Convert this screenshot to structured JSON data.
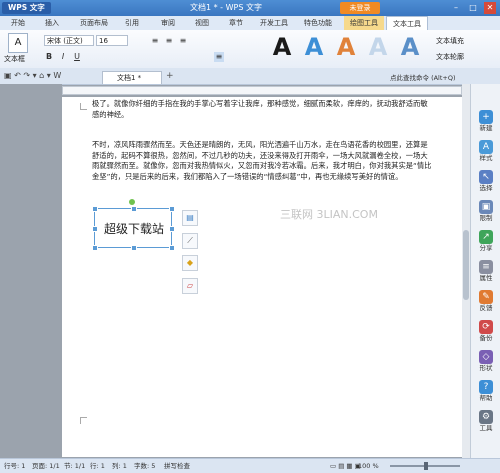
{
  "titlebar": {
    "app_button": "WPS 文字",
    "title": "文档1 * - WPS 文字",
    "login": "未登录",
    "minimize": "–",
    "maximize": "□",
    "close": "✕"
  },
  "tabs": [
    "开始",
    "插入",
    "页面布局",
    "引用",
    "审阅",
    "视图",
    "章节",
    "开发工具",
    "特色功能",
    "绘图工具",
    "文本工具"
  ],
  "ribbon": {
    "font_name": "宋体 (正文)",
    "font_size": "16",
    "textbox_label": "文本框",
    "bold": "B",
    "italic": "I",
    "underline": "U",
    "text_fill": "文本填充",
    "text_outline": "文本轮廓",
    "wordart_letters": [
      "A",
      "A",
      "A",
      "A",
      "A"
    ]
  },
  "doctab": {
    "label": "文档1 *"
  },
  "toolbar_right": {
    "hint": "点此查找命令 (Alt+Q)"
  },
  "document": {
    "para1": "极了。就像你纤细的手指在我的手掌心写着字让我痒，那种感觉，细腻而柔软，痒痒的，抚动我舒适而敏感的神经。",
    "para2": "不时，凉风阵雨骤然而至。天色还是晴朗的，无风，阳光洒遍千山万水，走在鸟语花香的校园里，还算是舒适的，起码不算很热，忽然间，不过几秒的功夫，还没来得及打开雨伞，一场大风就漏卷全校，一场大雨就骤然而至。就像你，忽而对我热情似火，又忽而对我冷若冰霜。后来，我才明白，你对我其实是“情比金坚”的，只是后来的后来，我们都陷入了一场错误的“情感纠葛”中，再也无缘续写美好的情谊。",
    "textbox_text": "超级下载站",
    "watermark": "三联网 3LIAN.COM"
  },
  "sidebar": [
    {
      "label": "新建",
      "icon": "new-icon",
      "color": "#3d8fd6"
    },
    {
      "label": "样式",
      "icon": "style-icon",
      "color": "#4a9ad8"
    },
    {
      "label": "选择",
      "icon": "select-icon",
      "color": "#5a7fc4"
    },
    {
      "label": "限制",
      "icon": "restrict-icon",
      "color": "#6a88b8"
    },
    {
      "label": "分享",
      "icon": "share-icon",
      "color": "#3fa55a"
    },
    {
      "label": "属性",
      "icon": "properties-icon",
      "color": "#8a8fa0"
    },
    {
      "label": "反馈",
      "icon": "feedback-icon",
      "color": "#e07a32"
    },
    {
      "label": "备份",
      "icon": "backup-icon",
      "color": "#d04a4a"
    },
    {
      "label": "形状",
      "icon": "shape-icon",
      "color": "#7a5fb4"
    },
    {
      "label": "帮助",
      "icon": "help-icon",
      "color": "#3d8fd6"
    },
    {
      "label": "工具",
      "icon": "tools-icon",
      "color": "#6a7686"
    }
  ],
  "status": {
    "row": "行号: 1",
    "page": "页面: 1/1",
    "section": "节: 1/1",
    "line": "行: 1",
    "column": "列: 1",
    "wordcount": "字数: 5",
    "spellcheck": "拼写检查",
    "zoom": "100 %"
  },
  "colors": {
    "accent": "#3a76c0",
    "wordart_fill": [
      "#1a1a1a",
      "#3d8fd6",
      "#e0823a",
      "#c3d6ea",
      "#5a8fc8"
    ]
  }
}
